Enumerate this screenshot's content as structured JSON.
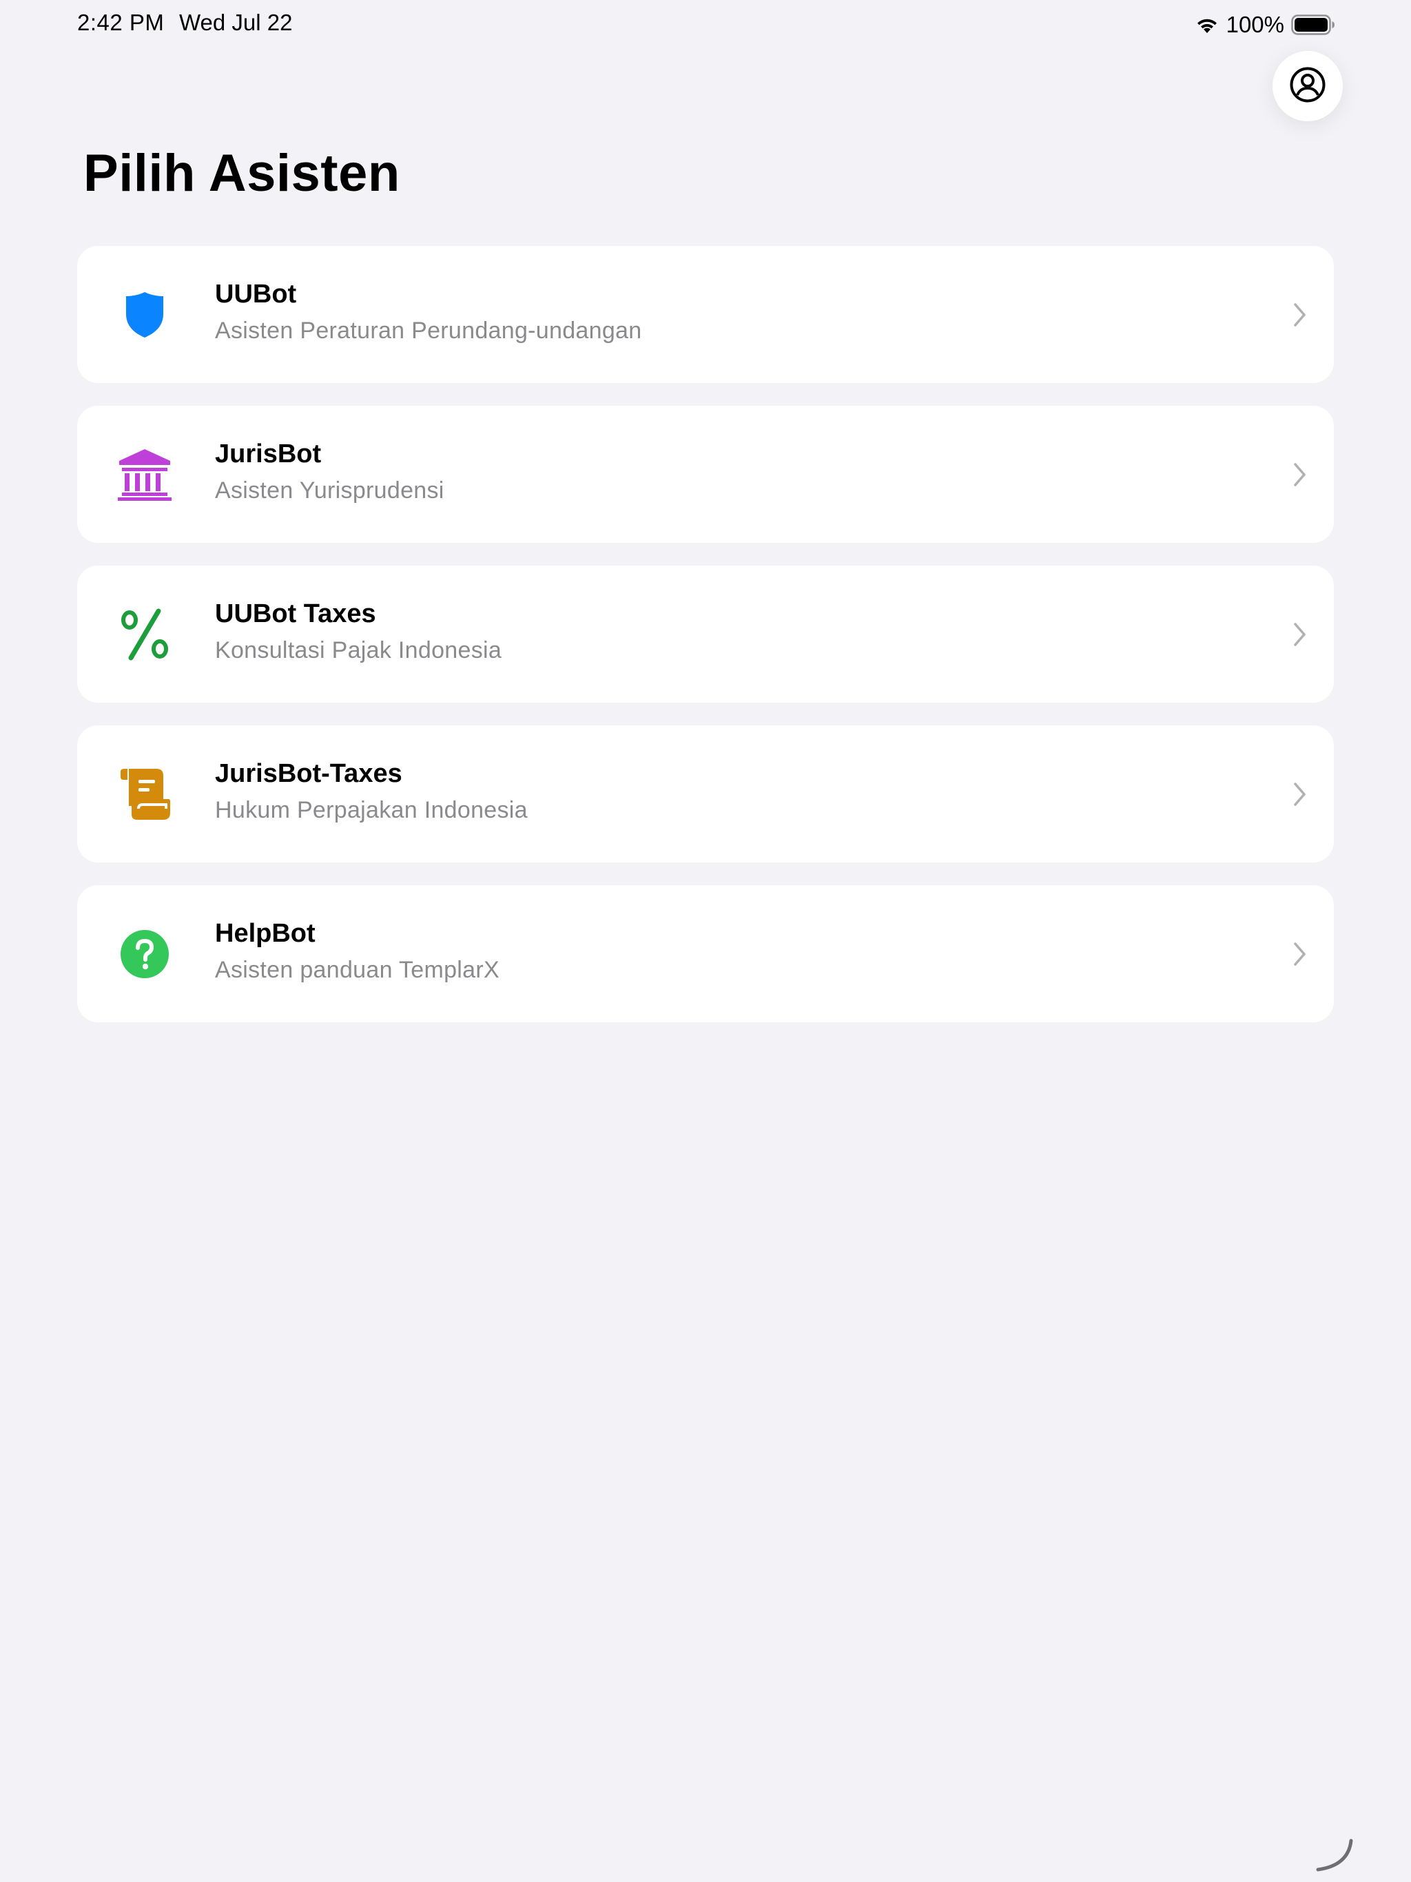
{
  "status_bar": {
    "time": "2:42 PM",
    "date": "Wed Jul 22",
    "battery_percent": "100%",
    "icons": [
      "wifi-icon",
      "battery-icon"
    ]
  },
  "header": {
    "profile_icon": "person-circle-icon",
    "title": "Pilih Asisten"
  },
  "assistants": [
    {
      "title": "UUBot",
      "subtitle": "Asisten Peraturan Perundang-undangan",
      "icon": "shield-icon",
      "color": "#0A84FF"
    },
    {
      "title": "JurisBot",
      "subtitle": "Asisten Yurisprudensi",
      "icon": "bank-building-icon",
      "color": "#BF40D9"
    },
    {
      "title": "UUBot Taxes",
      "subtitle": "Konsultasi Pajak Indonesia",
      "icon": "percent-icon",
      "color": "#1E9E3A"
    },
    {
      "title": "JurisBot-Taxes",
      "subtitle": "Hukum Perpajakan Indonesia",
      "icon": "scroll-icon",
      "color": "#D48A0B"
    },
    {
      "title": "HelpBot",
      "subtitle": "Asisten panduan TemplarX",
      "icon": "question-circle-icon",
      "color": "#34C759"
    }
  ],
  "colors": {
    "background": "#F2F2F7",
    "card": "#FFFFFF",
    "subtitle": "#8A8A8E",
    "chevron": "#B0B0B5"
  }
}
